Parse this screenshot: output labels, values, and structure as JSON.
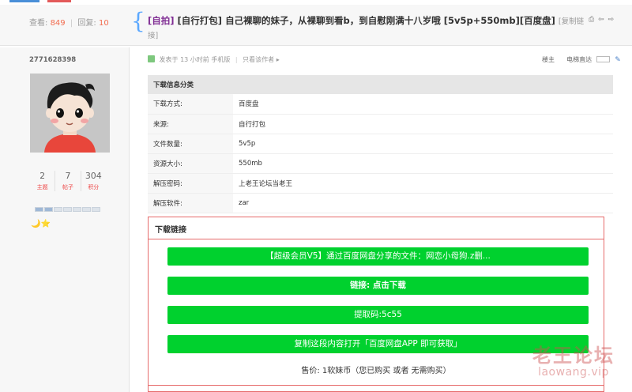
{
  "header": {
    "views_label": "查看:",
    "views": "849",
    "sep": "|",
    "replies_label": "回复:",
    "replies": "10",
    "title_tag1": "[自拍]",
    "title_tag2": "[自行打包]",
    "title_text": "自己裸聊的妹子，从裸聊到看b，到自慰刚满十八岁哦 [5v5p+550mb][百度盘]",
    "copy_link": "[复制链接]",
    "icons": "print-icon prev-icon next-icon"
  },
  "author": {
    "username": "2771628398",
    "stats": [
      {
        "value": "2",
        "label": "主题"
      },
      {
        "value": "7",
        "label": "帖子"
      },
      {
        "value": "304",
        "label": "积分"
      }
    ],
    "medals": "🌙⭐"
  },
  "post_meta": {
    "posted": "发表于 13 小时前 手机版",
    "sep": "|",
    "only_author": "只看该作者 ▸",
    "floor": "楼主",
    "elevator": "电梯直达"
  },
  "info_table": {
    "header": "下载信息分类",
    "rows": [
      {
        "key": "下载方式:",
        "value": "百度盘"
      },
      {
        "key": "来源:",
        "value": "自行打包"
      },
      {
        "key": "文件数量:",
        "value": "5v5p"
      },
      {
        "key": "资源大小:",
        "value": "550mb"
      },
      {
        "key": "解压密码:",
        "value": "上老王论坛当老王"
      },
      {
        "key": "解压软件:",
        "value": "zar"
      }
    ]
  },
  "download": {
    "title": "下载链接",
    "btn_share": "【超级会员V5】通过百度网盘分享的文件：网恋小母狗.z删...",
    "btn_link": "链接: 点击下载",
    "btn_code": "提取码:5c55",
    "btn_copy": "复制这段内容打开「百度网盘APP 即可获取」",
    "price": "售价:  1软妹币（您已购买 或者 无需购买）"
  },
  "watermark": {
    "cn": "老王论坛",
    "en": "laowang.vip"
  },
  "colors": {
    "accent_green": "#00d12e",
    "title_tag": "#7e2a92",
    "highlight_num": "#f26c4f",
    "box_border": "#e66b6b"
  }
}
